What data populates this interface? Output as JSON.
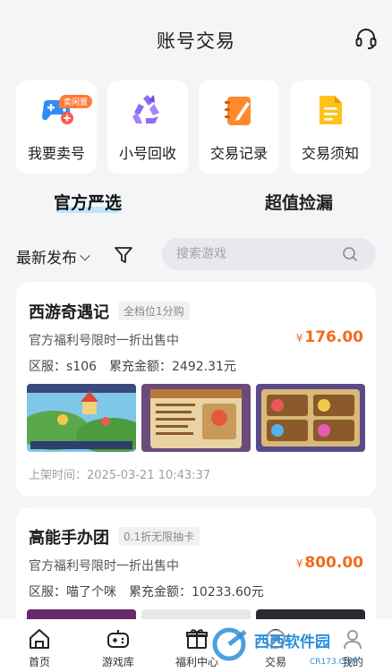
{
  "header": {
    "title": "账号交易",
    "service_icon": "headset-icon"
  },
  "quick_actions": [
    {
      "label": "我要卖号",
      "icon": "gamepad-plus-icon",
      "badge": "卖闲置"
    },
    {
      "label": "小号回收",
      "icon": "recycle-icon"
    },
    {
      "label": "交易记录",
      "icon": "notebook-icon"
    },
    {
      "label": "交易须知",
      "icon": "document-icon"
    }
  ],
  "tabs": [
    {
      "label": "官方严选",
      "active": true
    },
    {
      "label": "超值捡漏",
      "active": false
    }
  ],
  "filter": {
    "sort_label": "最新发布",
    "search_placeholder": "搜索游戏"
  },
  "listings": [
    {
      "game": "西游奇遇记",
      "tag": "全档位1分购",
      "desc": "官方福利号限时一折出售中",
      "price_symbol": "¥",
      "price": "176.00",
      "server_label": "区服：",
      "server": "s106",
      "recharge_label": "累充金额：",
      "recharge": "2492.31元",
      "time_label": "上架时间：",
      "time": "2025-03-21 10:43:37"
    },
    {
      "game": "高能手办团",
      "tag": "0.1折无限抽卡",
      "desc": "官方福利号限时一折出售中",
      "price_symbol": "¥",
      "price": "800.00",
      "server_label": "区服：",
      "server": "喵了个咪",
      "recharge_label": "累充金额：",
      "recharge": "10233.60元"
    }
  ],
  "tabbar": [
    {
      "label": "首页",
      "icon": "home-icon"
    },
    {
      "label": "游戏库",
      "icon": "gamepad-icon"
    },
    {
      "label": "福利中心",
      "icon": "gift-icon"
    },
    {
      "label": "交易",
      "icon": "trade-icon"
    },
    {
      "label": "我的",
      "icon": "user-icon"
    }
  ],
  "watermark": {
    "brand": "西西软件园",
    "url": "CR173.COM"
  },
  "colors": {
    "price": "#f26b1d",
    "tab_underline": "#bfe7ff",
    "background": "#f4f5f7"
  }
}
